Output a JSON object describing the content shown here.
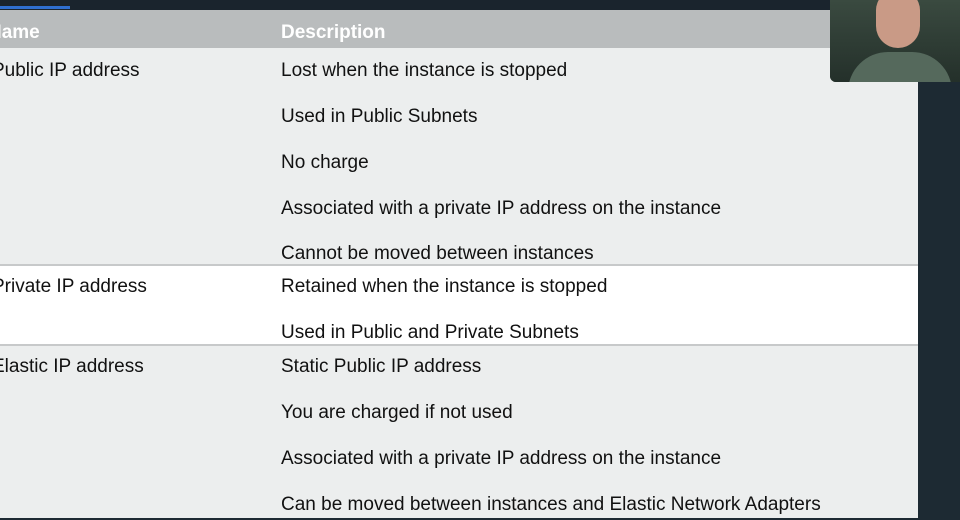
{
  "table": {
    "headers": {
      "name": "Name",
      "description": "Description"
    },
    "rows": [
      {
        "name": "Public IP address",
        "descriptions": [
          "Lost when the instance is stopped",
          "Used in Public Subnets",
          "No charge",
          "Associated with a private IP address on the instance",
          "Cannot be moved between instances"
        ]
      },
      {
        "name": "Private IP address",
        "descriptions": [
          "Retained when the instance is stopped",
          "Used in Public and Private Subnets"
        ]
      },
      {
        "name": "Elastic IP address",
        "descriptions": [
          "Static Public IP address",
          "You are charged if not used",
          "Associated with a private IP address on the instance",
          "Can be moved between instances and Elastic Network Adapters"
        ]
      }
    ]
  },
  "colors": {
    "header_bg": "#b9bcbd",
    "header_text": "#ffffff",
    "row_shaded": "#eceeee",
    "row_white": "#ffffff",
    "page_bg": "#1d2a33",
    "accent": "#2f6fd0"
  },
  "webcam": {
    "icon": "presenter-webcam-thumbnail"
  }
}
